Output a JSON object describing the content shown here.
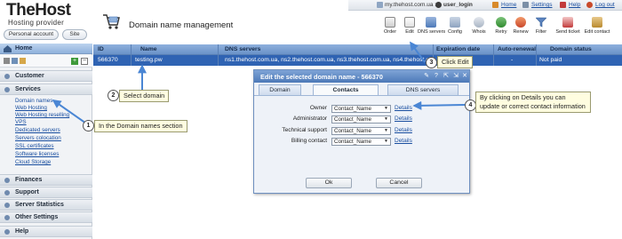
{
  "header": {
    "brand": "TheHost",
    "tagline": "Hosting provider",
    "personal_account": "Personal account",
    "site": "Site",
    "page_title": "Domain name management"
  },
  "topbar": {
    "host": "my.thehost.com.ua ::",
    "user": "user_login",
    "home": "Home",
    "settings": "Settings",
    "help": "Help",
    "logout": "Log out"
  },
  "toolbar": [
    {
      "label": "Order",
      "icon": "order-icon"
    },
    {
      "label": "Edit",
      "icon": "edit-icon"
    },
    {
      "label": "DNS servers",
      "icon": "dns-servers-icon"
    },
    {
      "label": "Config",
      "icon": "config-icon"
    },
    {
      "label": "Whois",
      "icon": "whois-icon"
    },
    {
      "label": "Retry",
      "icon": "retry-icon"
    },
    {
      "label": "Renew",
      "icon": "renew-icon"
    },
    {
      "label": "Filter",
      "icon": "filter-icon"
    },
    {
      "label": "Send ticket",
      "icon": "send-ticket-icon"
    },
    {
      "label": "Edit contact",
      "icon": "edit-contact-icon"
    }
  ],
  "sidebar": {
    "home": "Home",
    "sections": {
      "customer": "Customer",
      "services": "Services",
      "finances": "Finances",
      "support": "Support",
      "server_statistics": "Server Statistics",
      "other_settings": "Other Settings",
      "help": "Help"
    },
    "services_items": [
      "Domain names",
      "Web Hosting",
      "Web Hosting reselling",
      "VPS",
      "Dedicated servers",
      "Servers colocation",
      "SSL certificates",
      "Software licenses",
      "Cloud Storage"
    ]
  },
  "table": {
    "columns": {
      "id": "ID",
      "name": "Name",
      "dns": "DNS servers",
      "expiration": "Expiration date",
      "autorenewal": "Auto-renewal",
      "status": "Domain status"
    },
    "row": {
      "id": "566370",
      "name": "testing.pw",
      "dns": "ns1.thehost.com.ua, ns2.thehost.com.ua, ns3.thehost.com.ua, ns4.thehost.c",
      "autorenewal": "-",
      "status": "Not paid"
    }
  },
  "modal": {
    "title": "Edit the selected domain name - 566370",
    "tabs": [
      "Domain",
      "Contacts",
      "DNS servers"
    ],
    "active_tab": "Contacts",
    "fields": [
      {
        "label": "Owner",
        "value": "Contact_Name",
        "link": "Details"
      },
      {
        "label": "Administrator",
        "value": "Contact_Name",
        "link": "Details"
      },
      {
        "label": "Technical support",
        "value": "Contact_Name",
        "link": "Details"
      },
      {
        "label": "Billing contact",
        "value": "Contact_Name",
        "link": "Details"
      }
    ],
    "ok": "Ok",
    "cancel": "Cancel"
  },
  "callouts": [
    {
      "num": "1",
      "text": "In the Domain names section"
    },
    {
      "num": "2",
      "text": "Select domain"
    },
    {
      "num": "3",
      "text": "Click Edit"
    },
    {
      "num": "4",
      "text": "By clicking on Details you can update or correct contact information"
    }
  ],
  "colors": {
    "selected_row": "#2f63b3",
    "header_blue": "#7ea3d6",
    "callout_bg": "#fffde0"
  }
}
